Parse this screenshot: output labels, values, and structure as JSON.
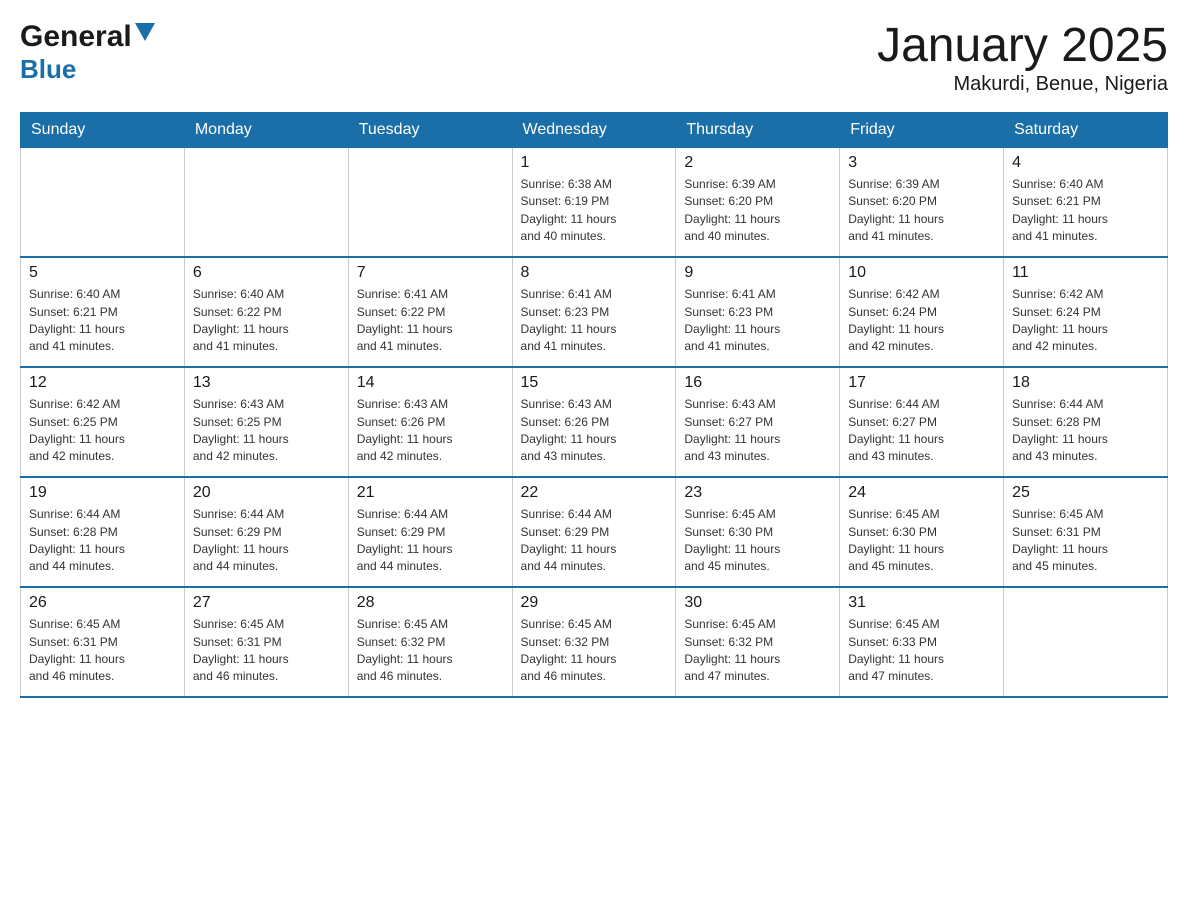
{
  "logo": {
    "general": "General",
    "blue": "Blue"
  },
  "title": "January 2025",
  "subtitle": "Makurdi, Benue, Nigeria",
  "weekdays": [
    "Sunday",
    "Monday",
    "Tuesday",
    "Wednesday",
    "Thursday",
    "Friday",
    "Saturday"
  ],
  "weeks": [
    [
      {
        "day": "",
        "info": ""
      },
      {
        "day": "",
        "info": ""
      },
      {
        "day": "",
        "info": ""
      },
      {
        "day": "1",
        "info": "Sunrise: 6:38 AM\nSunset: 6:19 PM\nDaylight: 11 hours\nand 40 minutes."
      },
      {
        "day": "2",
        "info": "Sunrise: 6:39 AM\nSunset: 6:20 PM\nDaylight: 11 hours\nand 40 minutes."
      },
      {
        "day": "3",
        "info": "Sunrise: 6:39 AM\nSunset: 6:20 PM\nDaylight: 11 hours\nand 41 minutes."
      },
      {
        "day": "4",
        "info": "Sunrise: 6:40 AM\nSunset: 6:21 PM\nDaylight: 11 hours\nand 41 minutes."
      }
    ],
    [
      {
        "day": "5",
        "info": "Sunrise: 6:40 AM\nSunset: 6:21 PM\nDaylight: 11 hours\nand 41 minutes."
      },
      {
        "day": "6",
        "info": "Sunrise: 6:40 AM\nSunset: 6:22 PM\nDaylight: 11 hours\nand 41 minutes."
      },
      {
        "day": "7",
        "info": "Sunrise: 6:41 AM\nSunset: 6:22 PM\nDaylight: 11 hours\nand 41 minutes."
      },
      {
        "day": "8",
        "info": "Sunrise: 6:41 AM\nSunset: 6:23 PM\nDaylight: 11 hours\nand 41 minutes."
      },
      {
        "day": "9",
        "info": "Sunrise: 6:41 AM\nSunset: 6:23 PM\nDaylight: 11 hours\nand 41 minutes."
      },
      {
        "day": "10",
        "info": "Sunrise: 6:42 AM\nSunset: 6:24 PM\nDaylight: 11 hours\nand 42 minutes."
      },
      {
        "day": "11",
        "info": "Sunrise: 6:42 AM\nSunset: 6:24 PM\nDaylight: 11 hours\nand 42 minutes."
      }
    ],
    [
      {
        "day": "12",
        "info": "Sunrise: 6:42 AM\nSunset: 6:25 PM\nDaylight: 11 hours\nand 42 minutes."
      },
      {
        "day": "13",
        "info": "Sunrise: 6:43 AM\nSunset: 6:25 PM\nDaylight: 11 hours\nand 42 minutes."
      },
      {
        "day": "14",
        "info": "Sunrise: 6:43 AM\nSunset: 6:26 PM\nDaylight: 11 hours\nand 42 minutes."
      },
      {
        "day": "15",
        "info": "Sunrise: 6:43 AM\nSunset: 6:26 PM\nDaylight: 11 hours\nand 43 minutes."
      },
      {
        "day": "16",
        "info": "Sunrise: 6:43 AM\nSunset: 6:27 PM\nDaylight: 11 hours\nand 43 minutes."
      },
      {
        "day": "17",
        "info": "Sunrise: 6:44 AM\nSunset: 6:27 PM\nDaylight: 11 hours\nand 43 minutes."
      },
      {
        "day": "18",
        "info": "Sunrise: 6:44 AM\nSunset: 6:28 PM\nDaylight: 11 hours\nand 43 minutes."
      }
    ],
    [
      {
        "day": "19",
        "info": "Sunrise: 6:44 AM\nSunset: 6:28 PM\nDaylight: 11 hours\nand 44 minutes."
      },
      {
        "day": "20",
        "info": "Sunrise: 6:44 AM\nSunset: 6:29 PM\nDaylight: 11 hours\nand 44 minutes."
      },
      {
        "day": "21",
        "info": "Sunrise: 6:44 AM\nSunset: 6:29 PM\nDaylight: 11 hours\nand 44 minutes."
      },
      {
        "day": "22",
        "info": "Sunrise: 6:44 AM\nSunset: 6:29 PM\nDaylight: 11 hours\nand 44 minutes."
      },
      {
        "day": "23",
        "info": "Sunrise: 6:45 AM\nSunset: 6:30 PM\nDaylight: 11 hours\nand 45 minutes."
      },
      {
        "day": "24",
        "info": "Sunrise: 6:45 AM\nSunset: 6:30 PM\nDaylight: 11 hours\nand 45 minutes."
      },
      {
        "day": "25",
        "info": "Sunrise: 6:45 AM\nSunset: 6:31 PM\nDaylight: 11 hours\nand 45 minutes."
      }
    ],
    [
      {
        "day": "26",
        "info": "Sunrise: 6:45 AM\nSunset: 6:31 PM\nDaylight: 11 hours\nand 46 minutes."
      },
      {
        "day": "27",
        "info": "Sunrise: 6:45 AM\nSunset: 6:31 PM\nDaylight: 11 hours\nand 46 minutes."
      },
      {
        "day": "28",
        "info": "Sunrise: 6:45 AM\nSunset: 6:32 PM\nDaylight: 11 hours\nand 46 minutes."
      },
      {
        "day": "29",
        "info": "Sunrise: 6:45 AM\nSunset: 6:32 PM\nDaylight: 11 hours\nand 46 minutes."
      },
      {
        "day": "30",
        "info": "Sunrise: 6:45 AM\nSunset: 6:32 PM\nDaylight: 11 hours\nand 47 minutes."
      },
      {
        "day": "31",
        "info": "Sunrise: 6:45 AM\nSunset: 6:33 PM\nDaylight: 11 hours\nand 47 minutes."
      },
      {
        "day": "",
        "info": ""
      }
    ]
  ]
}
